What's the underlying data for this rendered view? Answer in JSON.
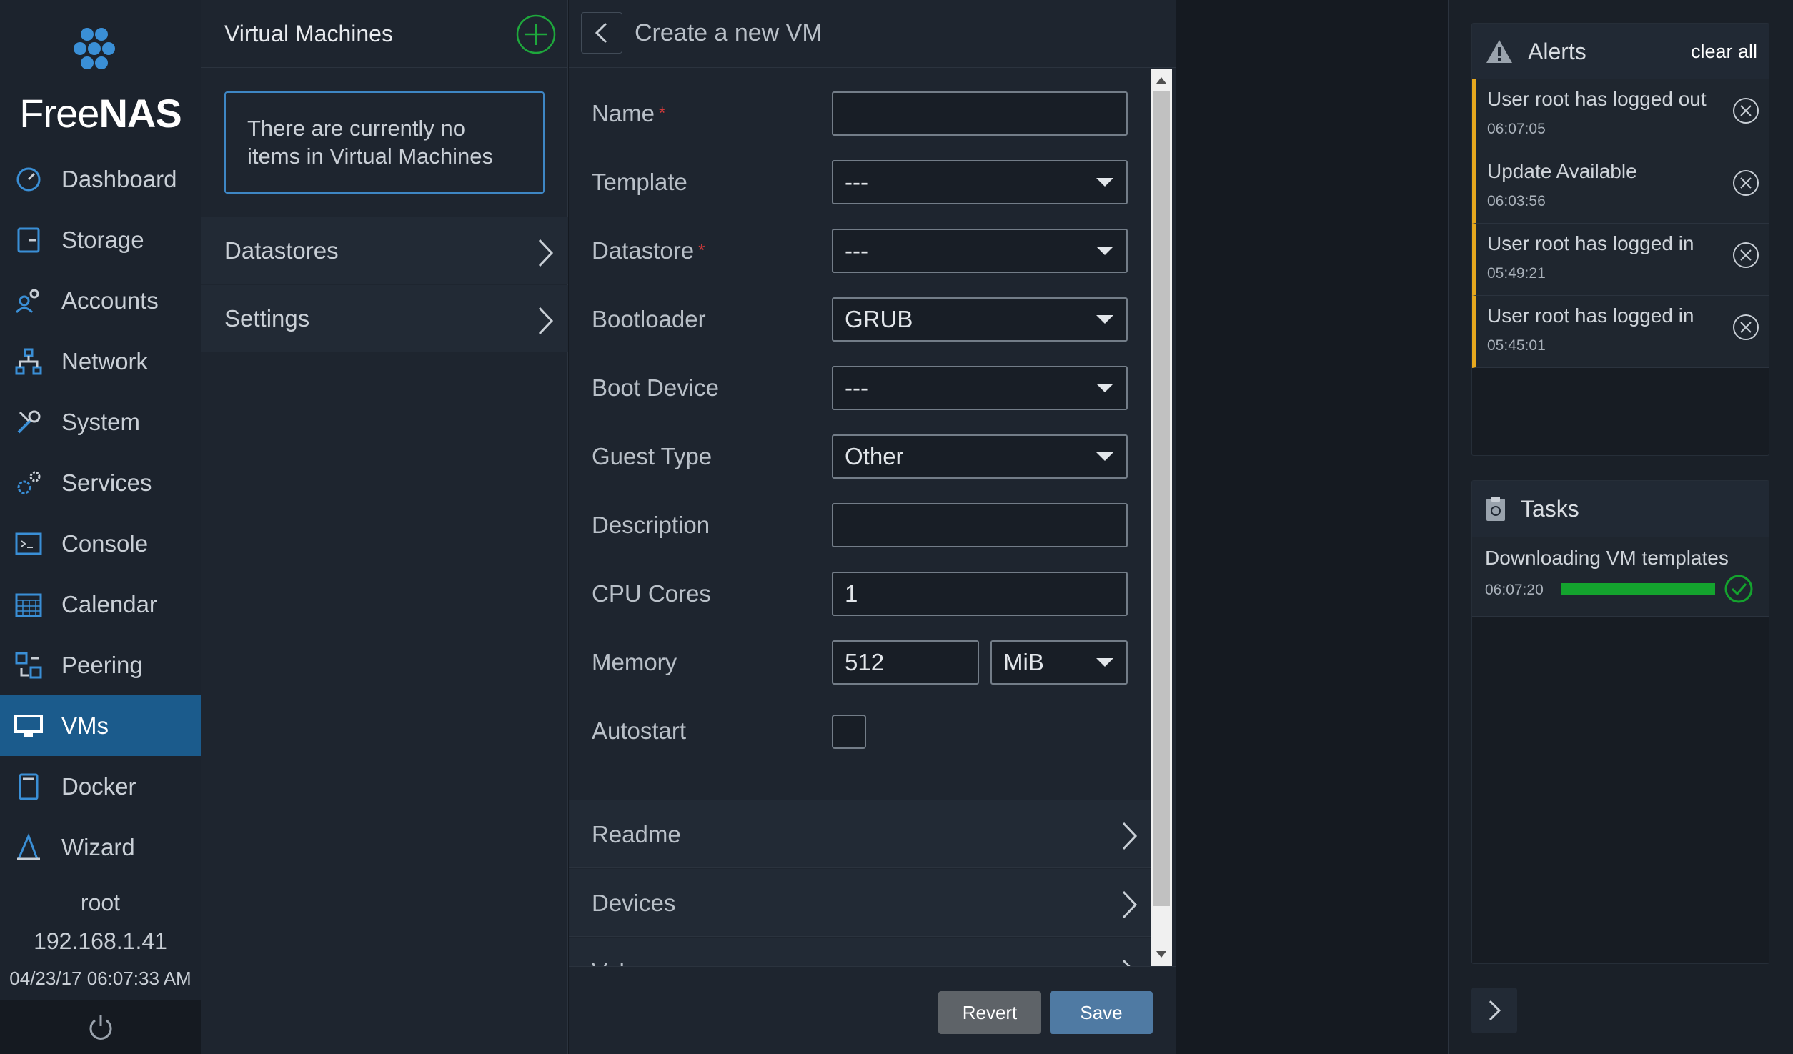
{
  "brand": {
    "name_light": "Free",
    "name_bold": "NAS"
  },
  "sidebar": {
    "items": [
      {
        "label": "Dashboard",
        "icon": "dashboard-icon"
      },
      {
        "label": "Storage",
        "icon": "storage-icon"
      },
      {
        "label": "Accounts",
        "icon": "accounts-icon"
      },
      {
        "label": "Network",
        "icon": "network-icon"
      },
      {
        "label": "System",
        "icon": "system-icon"
      },
      {
        "label": "Services",
        "icon": "services-icon"
      },
      {
        "label": "Console",
        "icon": "console-icon"
      },
      {
        "label": "Calendar",
        "icon": "calendar-icon"
      },
      {
        "label": "Peering",
        "icon": "peering-icon"
      },
      {
        "label": "VMs",
        "icon": "vms-icon",
        "active": true
      },
      {
        "label": "Docker",
        "icon": "docker-icon"
      },
      {
        "label": "Wizard",
        "icon": "wizard-icon"
      }
    ],
    "user": "root",
    "ip": "192.168.1.41",
    "datetime": "04/23/17  06:07:33 AM"
  },
  "vm_list": {
    "title": "Virtual Machines",
    "empty_message": "There are currently no items in Virtual Machines",
    "links": [
      "Datastores",
      "Settings"
    ]
  },
  "form": {
    "title": "Create a new VM",
    "fields": {
      "name": {
        "label": "Name",
        "value": "",
        "required": true
      },
      "template": {
        "label": "Template",
        "value": "---"
      },
      "datastore": {
        "label": "Datastore",
        "value": "---",
        "required": true
      },
      "bootloader": {
        "label": "Bootloader",
        "value": "GRUB"
      },
      "boot_device": {
        "label": "Boot Device",
        "value": "---"
      },
      "guest_type": {
        "label": "Guest Type",
        "value": "Other"
      },
      "description": {
        "label": "Description",
        "value": ""
      },
      "cpu_cores": {
        "label": "CPU Cores",
        "value": "1"
      },
      "memory": {
        "label": "Memory",
        "value": "512",
        "unit": "MiB"
      },
      "autostart": {
        "label": "Autostart",
        "checked": false
      }
    },
    "sections": [
      "Readme",
      "Devices",
      "Volumes"
    ],
    "revert_label": "Revert",
    "save_label": "Save"
  },
  "alerts": {
    "title": "Alerts",
    "clear_label": "clear all",
    "items": [
      {
        "message": "User root has logged out",
        "time": "06:07:05"
      },
      {
        "message": "Update Available",
        "time": "06:03:56"
      },
      {
        "message": "User root has logged in",
        "time": "05:49:21"
      },
      {
        "message": "User root has logged in",
        "time": "05:45:01"
      }
    ]
  },
  "tasks": {
    "title": "Tasks",
    "items": [
      {
        "message": "Downloading VM templates",
        "time": "06:07:20",
        "progress": 1.0,
        "status": "complete"
      }
    ]
  },
  "colors": {
    "accent": "#1b5b8c",
    "alert": "#e6a81e",
    "success": "#14a32e",
    "required": "#d03a3a"
  }
}
